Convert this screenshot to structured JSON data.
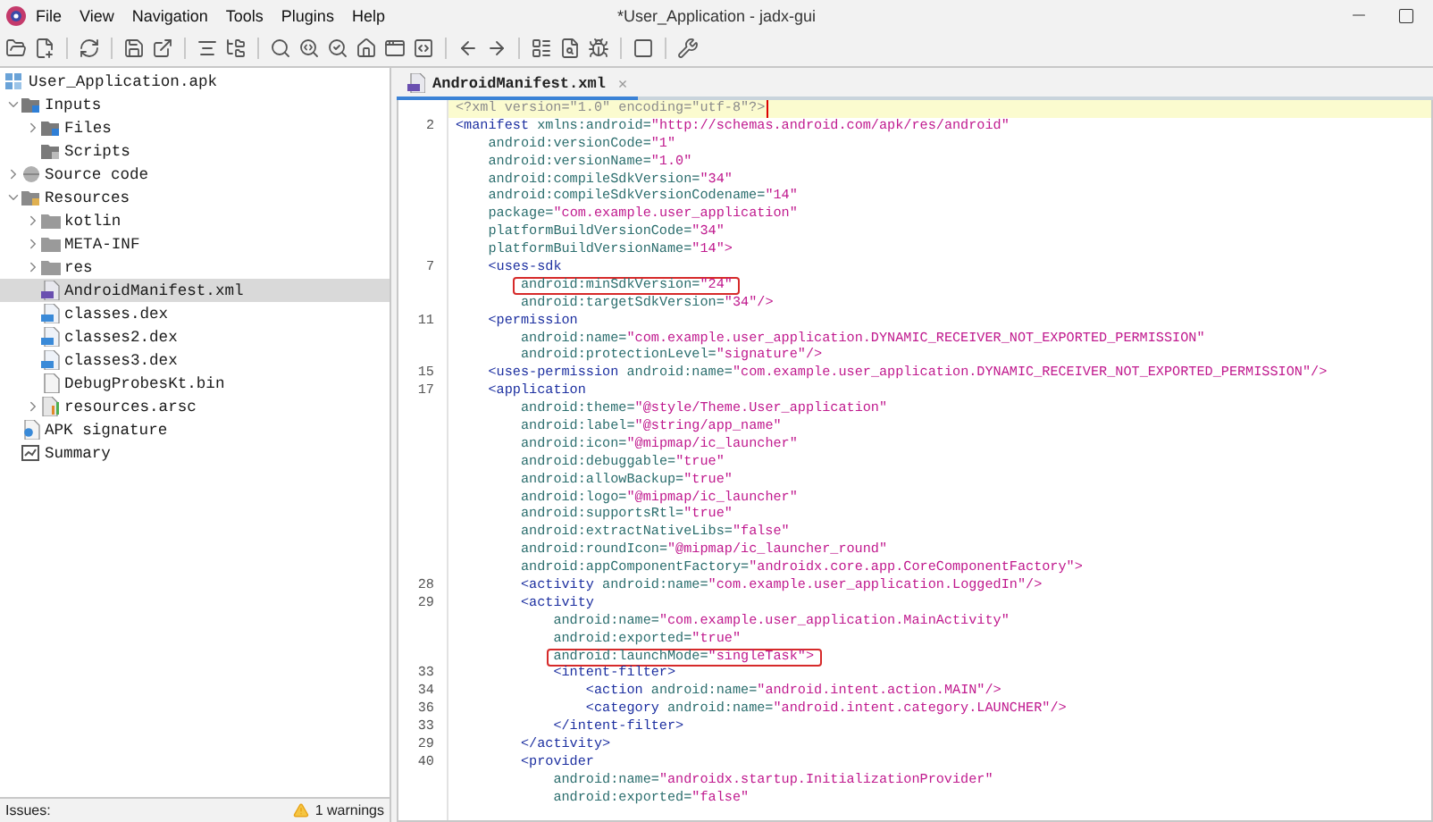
{
  "window": {
    "title": "*User_Application - jadx-gui"
  },
  "menu": [
    "File",
    "View",
    "Navigation",
    "Tools",
    "Plugins",
    "Help"
  ],
  "tree": [
    {
      "label": "User_Application.apk",
      "kind": "apk",
      "selected": false,
      "children": [
        {
          "label": "Inputs",
          "kind": "folder-input",
          "expanded": true,
          "selected": false,
          "children": [
            {
              "label": "Files",
              "kind": "folder-input",
              "expanded": false,
              "selected": false
            },
            {
              "label": "Scripts",
              "kind": "folder-script",
              "selected": false
            }
          ]
        },
        {
          "label": "Source code",
          "kind": "package",
          "expanded": false,
          "selected": false
        },
        {
          "label": "Resources",
          "kind": "folder-res",
          "expanded": true,
          "selected": false,
          "children": [
            {
              "label": "kotlin",
              "kind": "folder",
              "expanded": false,
              "selected": false
            },
            {
              "label": "META-INF",
              "kind": "folder",
              "expanded": false,
              "selected": false
            },
            {
              "label": "res",
              "kind": "folder",
              "expanded": false,
              "selected": false
            },
            {
              "label": "AndroidManifest.xml",
              "kind": "manifest",
              "selected": true
            },
            {
              "label": "classes.dex",
              "kind": "dex",
              "selected": false
            },
            {
              "label": "classes2.dex",
              "kind": "dex",
              "selected": false
            },
            {
              "label": "classes3.dex",
              "kind": "dex",
              "selected": false
            },
            {
              "label": "DebugProbesKt.bin",
              "kind": "file",
              "selected": false
            },
            {
              "label": "resources.arsc",
              "kind": "arsc",
              "expanded": false,
              "selected": false
            }
          ]
        },
        {
          "label": "APK signature",
          "kind": "signature",
          "selected": false
        },
        {
          "label": "Summary",
          "kind": "summary",
          "selected": false
        }
      ]
    }
  ],
  "status_bar": {
    "issues_label": "Issues:",
    "warnings": "1 warnings"
  },
  "tabs": [
    {
      "label": "AndroidManifest.xml",
      "close": "×",
      "selected": true
    }
  ],
  "code": [
    {
      "current": true,
      "boxed": false,
      "tokens": [
        {
          "kind": "decl",
          "text": "<?xml version=\"1.0\" encoding=\"utf-8\"?>"
        }
      ]
    },
    {
      "number": "2",
      "current": false,
      "boxed": false,
      "tokens": [
        {
          "kind": "tag",
          "text": "<manifest "
        },
        {
          "kind": "attr",
          "text": "xmlns:android="
        },
        {
          "kind": "value",
          "text": "\"http://schemas.android.com/apk/res/android\""
        }
      ]
    },
    {
      "current": false,
      "boxed": false,
      "tokens": [
        {
          "kind": "attr",
          "text": "    android:versionCode="
        },
        {
          "kind": "value",
          "text": "\"1\""
        }
      ]
    },
    {
      "current": false,
      "boxed": false,
      "tokens": [
        {
          "kind": "attr",
          "text": "    android:versionName="
        },
        {
          "kind": "value",
          "text": "\"1.0\""
        }
      ]
    },
    {
      "current": false,
      "boxed": false,
      "tokens": [
        {
          "kind": "attr",
          "text": "    android:compileSdkVersion="
        },
        {
          "kind": "value",
          "text": "\"34\""
        }
      ]
    },
    {
      "current": false,
      "boxed": false,
      "tokens": [
        {
          "kind": "attr",
          "text": "    android:compileSdkVersionCodename="
        },
        {
          "kind": "value",
          "text": "\"14\""
        }
      ]
    },
    {
      "current": false,
      "boxed": false,
      "tokens": [
        {
          "kind": "attr",
          "text": "    package="
        },
        {
          "kind": "value",
          "text": "\"com.example.user_application\""
        }
      ]
    },
    {
      "current": false,
      "boxed": false,
      "tokens": [
        {
          "kind": "attr",
          "text": "    platformBuildVersionCode="
        },
        {
          "kind": "value",
          "text": "\"34\""
        }
      ]
    },
    {
      "current": false,
      "boxed": false,
      "tokens": [
        {
          "kind": "attr",
          "text": "    platformBuildVersionName="
        },
        {
          "kind": "value",
          "text": "\"14\""
        },
        {
          "kind": "punct",
          "text": ">"
        }
      ]
    },
    {
      "number": "7",
      "current": false,
      "boxed": false,
      "tokens": [
        {
          "kind": "tag",
          "text": "    <uses-sdk"
        }
      ]
    },
    {
      "current": false,
      "boxed": true,
      "tokens": [
        {
          "kind": "attr",
          "text": "        android:minSdkVersion="
        },
        {
          "kind": "value",
          "text": "\"24\""
        }
      ]
    },
    {
      "current": false,
      "boxed": false,
      "tokens": [
        {
          "kind": "attr",
          "text": "        android:targetSdkVersion="
        },
        {
          "kind": "value",
          "text": "\"34\""
        },
        {
          "kind": "punct",
          "text": "/>"
        }
      ]
    },
    {
      "number": "11",
      "current": false,
      "boxed": false,
      "tokens": [
        {
          "kind": "tag",
          "text": "    <permission"
        }
      ]
    },
    {
      "current": false,
      "boxed": false,
      "tokens": [
        {
          "kind": "attr",
          "text": "        android:name="
        },
        {
          "kind": "value",
          "text": "\"com.example.user_application.DYNAMIC_RECEIVER_NOT_EXPORTED_PERMISSION\""
        }
      ]
    },
    {
      "current": false,
      "boxed": false,
      "tokens": [
        {
          "kind": "attr",
          "text": "        android:protectionLevel="
        },
        {
          "kind": "value",
          "text": "\"signature\""
        },
        {
          "kind": "punct",
          "text": "/>"
        }
      ]
    },
    {
      "number": "15",
      "current": false,
      "boxed": false,
      "tokens": [
        {
          "kind": "tag",
          "text": "    <uses-permission "
        },
        {
          "kind": "attr",
          "text": "android:name="
        },
        {
          "kind": "value",
          "text": "\"com.example.user_application.DYNAMIC_RECEIVER_NOT_EXPORTED_PERMISSION\""
        },
        {
          "kind": "punct",
          "text": "/>"
        }
      ]
    },
    {
      "number": "17",
      "current": false,
      "boxed": false,
      "tokens": [
        {
          "kind": "tag",
          "text": "    <application"
        }
      ]
    },
    {
      "current": false,
      "boxed": false,
      "tokens": [
        {
          "kind": "attr",
          "text": "        android:theme="
        },
        {
          "kind": "value",
          "text": "\"@style/Theme.User_application\""
        }
      ]
    },
    {
      "current": false,
      "boxed": false,
      "tokens": [
        {
          "kind": "attr",
          "text": "        android:label="
        },
        {
          "kind": "value",
          "text": "\"@string/app_name\""
        }
      ]
    },
    {
      "current": false,
      "boxed": false,
      "tokens": [
        {
          "kind": "attr",
          "text": "        android:icon="
        },
        {
          "kind": "value",
          "text": "\"@mipmap/ic_launcher\""
        }
      ]
    },
    {
      "current": false,
      "boxed": false,
      "tokens": [
        {
          "kind": "attr",
          "text": "        android:debuggable="
        },
        {
          "kind": "value",
          "text": "\"true\""
        }
      ]
    },
    {
      "current": false,
      "boxed": false,
      "tokens": [
        {
          "kind": "attr",
          "text": "        android:allowBackup="
        },
        {
          "kind": "value",
          "text": "\"true\""
        }
      ]
    },
    {
      "current": false,
      "boxed": false,
      "tokens": [
        {
          "kind": "attr",
          "text": "        android:logo="
        },
        {
          "kind": "value",
          "text": "\"@mipmap/ic_launcher\""
        }
      ]
    },
    {
      "current": false,
      "boxed": false,
      "tokens": [
        {
          "kind": "attr",
          "text": "        android:supportsRtl="
        },
        {
          "kind": "value",
          "text": "\"true\""
        }
      ]
    },
    {
      "current": false,
      "boxed": false,
      "tokens": [
        {
          "kind": "attr",
          "text": "        android:extractNativeLibs="
        },
        {
          "kind": "value",
          "text": "\"false\""
        }
      ]
    },
    {
      "current": false,
      "boxed": false,
      "tokens": [
        {
          "kind": "attr",
          "text": "        android:roundIcon="
        },
        {
          "kind": "value",
          "text": "\"@mipmap/ic_launcher_round\""
        }
      ]
    },
    {
      "current": false,
      "boxed": false,
      "tokens": [
        {
          "kind": "attr",
          "text": "        android:appComponentFactory="
        },
        {
          "kind": "value",
          "text": "\"androidx.core.app.CoreComponentFactory\""
        },
        {
          "kind": "punct",
          "text": ">"
        }
      ]
    },
    {
      "number": "28",
      "current": false,
      "boxed": false,
      "tokens": [
        {
          "kind": "tag",
          "text": "        <activity "
        },
        {
          "kind": "attr",
          "text": "android:name="
        },
        {
          "kind": "value",
          "text": "\"com.example.user_application.LoggedIn\""
        },
        {
          "kind": "punct",
          "text": "/>"
        }
      ]
    },
    {
      "number": "29",
      "current": false,
      "boxed": false,
      "tokens": [
        {
          "kind": "tag",
          "text": "        <activity"
        }
      ]
    },
    {
      "current": false,
      "boxed": false,
      "tokens": [
        {
          "kind": "attr",
          "text": "            android:name="
        },
        {
          "kind": "value",
          "text": "\"com.example.user_application.MainActivity\""
        }
      ]
    },
    {
      "current": false,
      "boxed": false,
      "tokens": [
        {
          "kind": "attr",
          "text": "            android:exported="
        },
        {
          "kind": "value",
          "text": "\"true\""
        }
      ]
    },
    {
      "current": false,
      "boxed": true,
      "tokens": [
        {
          "kind": "attr",
          "text": "            android:launchMode="
        },
        {
          "kind": "value",
          "text": "\"singleTask\""
        },
        {
          "kind": "punct",
          "text": ">"
        }
      ]
    },
    {
      "number": "33",
      "current": false,
      "boxed": false,
      "tokens": [
        {
          "kind": "tag",
          "text": "            <intent-filter>"
        }
      ]
    },
    {
      "number": "34",
      "current": false,
      "boxed": false,
      "tokens": [
        {
          "kind": "tag",
          "text": "                <action "
        },
        {
          "kind": "attr",
          "text": "android:name="
        },
        {
          "kind": "value",
          "text": "\"android.intent.action.MAIN\""
        },
        {
          "kind": "punct",
          "text": "/>"
        }
      ]
    },
    {
      "number": "36",
      "current": false,
      "boxed": false,
      "tokens": [
        {
          "kind": "tag",
          "text": "                <category "
        },
        {
          "kind": "attr",
          "text": "android:name="
        },
        {
          "kind": "value",
          "text": "\"android.intent.category.LAUNCHER\""
        },
        {
          "kind": "punct",
          "text": "/>"
        }
      ]
    },
    {
      "number": "33",
      "current": false,
      "boxed": false,
      "tokens": [
        {
          "kind": "tag",
          "text": "            </intent-filter>"
        }
      ]
    },
    {
      "number": "29",
      "current": false,
      "boxed": false,
      "tokens": [
        {
          "kind": "tag",
          "text": "        </activity>"
        }
      ]
    },
    {
      "number": "40",
      "current": false,
      "boxed": false,
      "tokens": [
        {
          "kind": "tag",
          "text": "        <provider"
        }
      ]
    },
    {
      "current": false,
      "boxed": false,
      "tokens": [
        {
          "kind": "attr",
          "text": "            android:name="
        },
        {
          "kind": "value",
          "text": "\"androidx.startup.InitializationProvider\""
        }
      ]
    },
    {
      "current": false,
      "boxed": false,
      "tokens": [
        {
          "kind": "attr",
          "text": "            android:exported="
        },
        {
          "kind": "value",
          "text": "\"false\""
        }
      ]
    }
  ]
}
